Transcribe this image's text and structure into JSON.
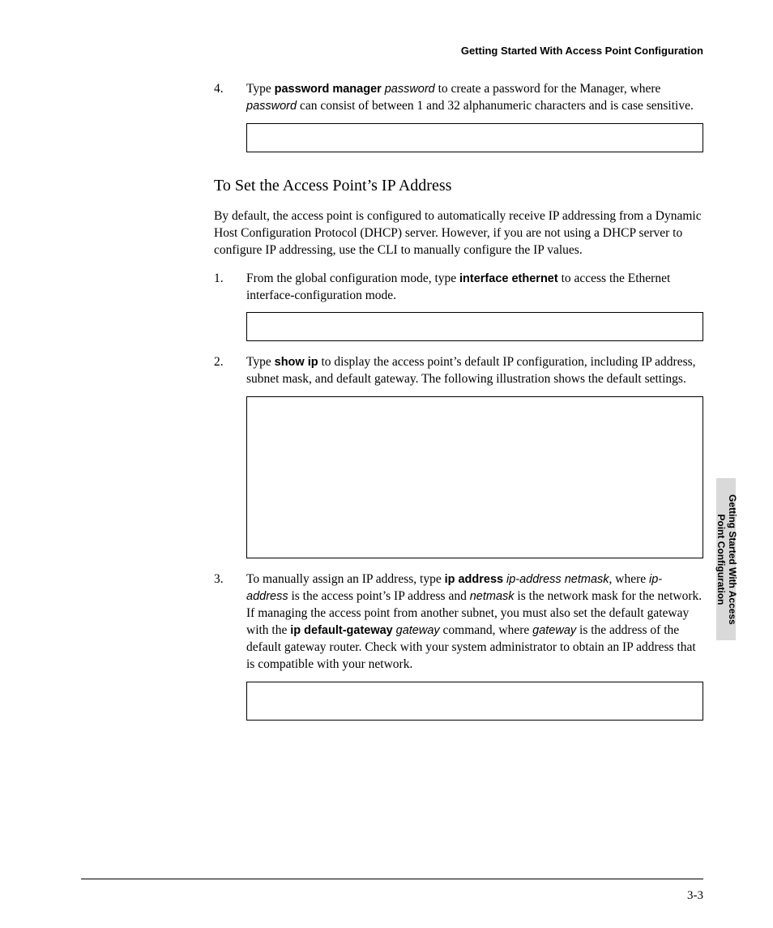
{
  "running_head": "Getting Started With Access Point Configuration",
  "side_tab_line1": "Getting Started With Access",
  "side_tab_line2": "Point Configuration",
  "page_number": "3-3",
  "step4": {
    "num": "4.",
    "t1": "Type ",
    "cmd": "password manager",
    "sp": " ",
    "arg": "password",
    "t2": " to create a password for the Manager, where ",
    "arg2": "password",
    "t3": " can consist of between 1 and 32 alphanumeric characters and is case sensitive."
  },
  "section_heading": "To Set the Access Point’s IP Address",
  "intro": "By default, the access point is configured to automatically receive IP addressing from a Dynamic Host Configuration Protocol (DHCP) server. However, if you are not using a DHCP server to configure IP addressing, use the CLI to manually configure the IP values.",
  "ip": {
    "s1": {
      "num": "1.",
      "t1": "From the global configuration mode, type ",
      "cmd": "interface ethernet",
      "t2": " to access the Ethernet interface-configuration mode."
    },
    "s2": {
      "num": "2.",
      "t1": "Type ",
      "cmd": "show ip",
      "t2": " to display the access point’s default IP configuration, including IP address, subnet mask, and default gateway. The following illustration shows the default settings."
    },
    "s3": {
      "num": "3.",
      "t1": "To manually assign an IP address, type ",
      "cmd1": "ip address",
      "sp": " ",
      "arg1": "ip-address netmask",
      "t2": ", where ",
      "arg2": "ip-address",
      "t3": " is the access point’s IP address and ",
      "arg3": "netmask",
      "t4": " is the network mask for the network. If managing the access point from another subnet, you must also set the default gateway with the ",
      "cmd2": "ip default-gateway",
      "sp2": " ",
      "arg4": "gateway",
      "t5": " command, where ",
      "arg5": "gateway",
      "t6": " is the address of the default gateway router. Check with your system administrator to obtain an IP address that is compatible with your network."
    }
  }
}
